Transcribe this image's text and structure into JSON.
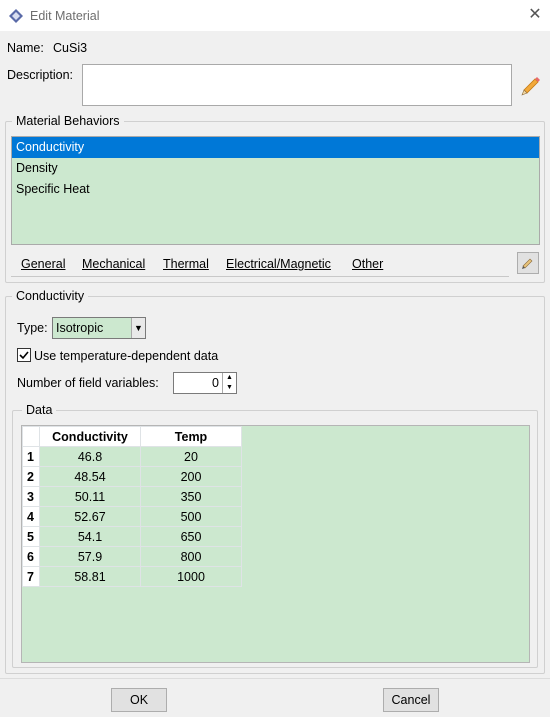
{
  "window": {
    "title": "Edit Material",
    "close_glyph": "✕"
  },
  "name_label": "Name:",
  "name_value": "CuSi3",
  "description_label": "Description:",
  "description_value": "",
  "behaviors": {
    "legend": "Material Behaviors",
    "items": [
      "Conductivity",
      "Density",
      "Specific Heat"
    ],
    "selected_index": 0
  },
  "menu": {
    "items": [
      {
        "label": "General"
      },
      {
        "label": "Mechanical"
      },
      {
        "label": "Thermal"
      },
      {
        "label": "Electrical/Magnetic"
      },
      {
        "label": "Other"
      }
    ]
  },
  "conductivity": {
    "legend": "Conductivity",
    "type_label": "Type:",
    "type_value": "Isotropic",
    "temp_dependent_label": "Use temperature-dependent data",
    "temp_dependent_checked": true,
    "field_vars_label": "Number of field variables:",
    "field_vars_value": "0"
  },
  "data_table": {
    "legend": "Data",
    "columns": [
      "Conductivity",
      "Temp"
    ],
    "rows": [
      {
        "n": "1",
        "c": "46.8",
        "t": "20"
      },
      {
        "n": "2",
        "c": "48.54",
        "t": "200"
      },
      {
        "n": "3",
        "c": "50.11",
        "t": "350"
      },
      {
        "n": "4",
        "c": "52.67",
        "t": "500"
      },
      {
        "n": "5",
        "c": "54.1",
        "t": "650"
      },
      {
        "n": "6",
        "c": "57.9",
        "t": "800"
      },
      {
        "n": "7",
        "c": "58.81",
        "t": "1000"
      }
    ]
  },
  "buttons": {
    "ok": "OK",
    "cancel": "Cancel"
  },
  "colors": {
    "selection": "#0078d7",
    "list_bg": "#cce8cf",
    "dialog_bg": "#f0f0f0"
  },
  "icons": {
    "edit_description": "pencil-icon",
    "menu_edit": "pencil-icon",
    "app": "abaqus-icon",
    "dropdown": "chevron-down-icon"
  }
}
